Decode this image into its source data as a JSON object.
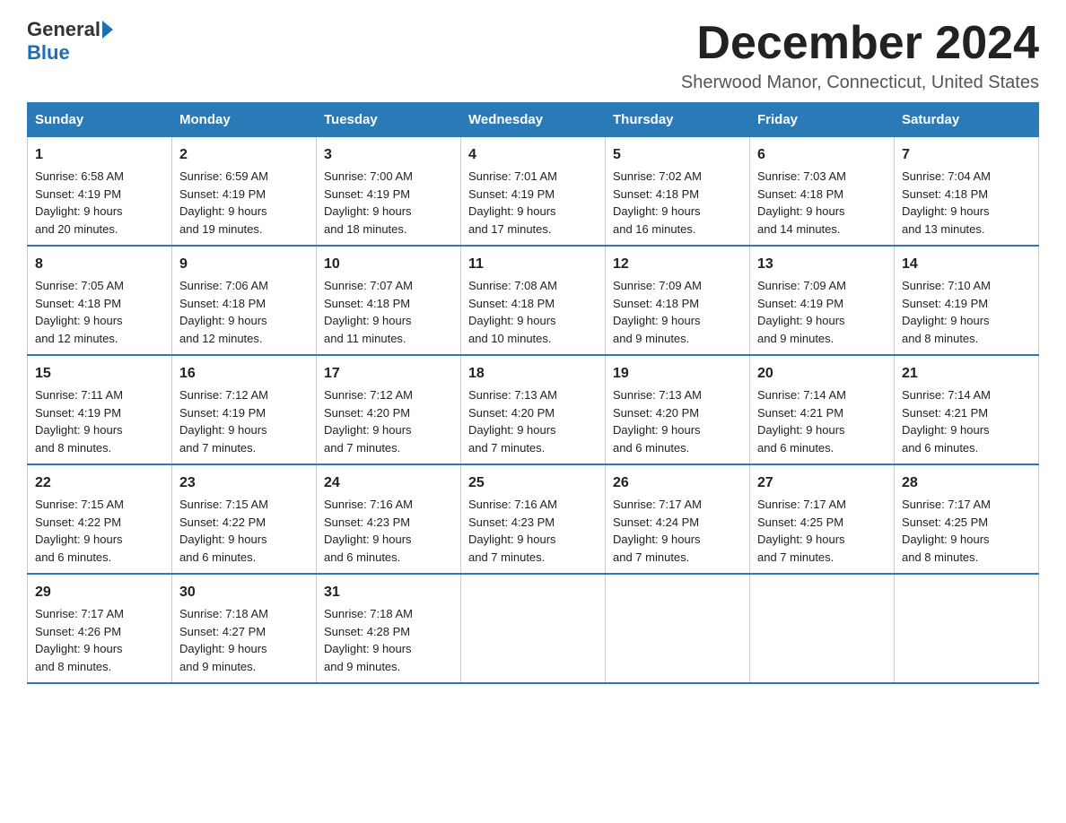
{
  "logo": {
    "general": "General",
    "blue": "Blue"
  },
  "title": "December 2024",
  "location": "Sherwood Manor, Connecticut, United States",
  "days_of_week": [
    "Sunday",
    "Monday",
    "Tuesday",
    "Wednesday",
    "Thursday",
    "Friday",
    "Saturday"
  ],
  "weeks": [
    [
      {
        "day": "1",
        "sunrise": "6:58 AM",
        "sunset": "4:19 PM",
        "daylight": "9 hours and 20 minutes."
      },
      {
        "day": "2",
        "sunrise": "6:59 AM",
        "sunset": "4:19 PM",
        "daylight": "9 hours and 19 minutes."
      },
      {
        "day": "3",
        "sunrise": "7:00 AM",
        "sunset": "4:19 PM",
        "daylight": "9 hours and 18 minutes."
      },
      {
        "day": "4",
        "sunrise": "7:01 AM",
        "sunset": "4:19 PM",
        "daylight": "9 hours and 17 minutes."
      },
      {
        "day": "5",
        "sunrise": "7:02 AM",
        "sunset": "4:18 PM",
        "daylight": "9 hours and 16 minutes."
      },
      {
        "day": "6",
        "sunrise": "7:03 AM",
        "sunset": "4:18 PM",
        "daylight": "9 hours and 14 minutes."
      },
      {
        "day": "7",
        "sunrise": "7:04 AM",
        "sunset": "4:18 PM",
        "daylight": "9 hours and 13 minutes."
      }
    ],
    [
      {
        "day": "8",
        "sunrise": "7:05 AM",
        "sunset": "4:18 PM",
        "daylight": "9 hours and 12 minutes."
      },
      {
        "day": "9",
        "sunrise": "7:06 AM",
        "sunset": "4:18 PM",
        "daylight": "9 hours and 12 minutes."
      },
      {
        "day": "10",
        "sunrise": "7:07 AM",
        "sunset": "4:18 PM",
        "daylight": "9 hours and 11 minutes."
      },
      {
        "day": "11",
        "sunrise": "7:08 AM",
        "sunset": "4:18 PM",
        "daylight": "9 hours and 10 minutes."
      },
      {
        "day": "12",
        "sunrise": "7:09 AM",
        "sunset": "4:18 PM",
        "daylight": "9 hours and 9 minutes."
      },
      {
        "day": "13",
        "sunrise": "7:09 AM",
        "sunset": "4:19 PM",
        "daylight": "9 hours and 9 minutes."
      },
      {
        "day": "14",
        "sunrise": "7:10 AM",
        "sunset": "4:19 PM",
        "daylight": "9 hours and 8 minutes."
      }
    ],
    [
      {
        "day": "15",
        "sunrise": "7:11 AM",
        "sunset": "4:19 PM",
        "daylight": "9 hours and 8 minutes."
      },
      {
        "day": "16",
        "sunrise": "7:12 AM",
        "sunset": "4:19 PM",
        "daylight": "9 hours and 7 minutes."
      },
      {
        "day": "17",
        "sunrise": "7:12 AM",
        "sunset": "4:20 PM",
        "daylight": "9 hours and 7 minutes."
      },
      {
        "day": "18",
        "sunrise": "7:13 AM",
        "sunset": "4:20 PM",
        "daylight": "9 hours and 7 minutes."
      },
      {
        "day": "19",
        "sunrise": "7:13 AM",
        "sunset": "4:20 PM",
        "daylight": "9 hours and 6 minutes."
      },
      {
        "day": "20",
        "sunrise": "7:14 AM",
        "sunset": "4:21 PM",
        "daylight": "9 hours and 6 minutes."
      },
      {
        "day": "21",
        "sunrise": "7:14 AM",
        "sunset": "4:21 PM",
        "daylight": "9 hours and 6 minutes."
      }
    ],
    [
      {
        "day": "22",
        "sunrise": "7:15 AM",
        "sunset": "4:22 PM",
        "daylight": "9 hours and 6 minutes."
      },
      {
        "day": "23",
        "sunrise": "7:15 AM",
        "sunset": "4:22 PM",
        "daylight": "9 hours and 6 minutes."
      },
      {
        "day": "24",
        "sunrise": "7:16 AM",
        "sunset": "4:23 PM",
        "daylight": "9 hours and 6 minutes."
      },
      {
        "day": "25",
        "sunrise": "7:16 AM",
        "sunset": "4:23 PM",
        "daylight": "9 hours and 7 minutes."
      },
      {
        "day": "26",
        "sunrise": "7:17 AM",
        "sunset": "4:24 PM",
        "daylight": "9 hours and 7 minutes."
      },
      {
        "day": "27",
        "sunrise": "7:17 AM",
        "sunset": "4:25 PM",
        "daylight": "9 hours and 7 minutes."
      },
      {
        "day": "28",
        "sunrise": "7:17 AM",
        "sunset": "4:25 PM",
        "daylight": "9 hours and 8 minutes."
      }
    ],
    [
      {
        "day": "29",
        "sunrise": "7:17 AM",
        "sunset": "4:26 PM",
        "daylight": "9 hours and 8 minutes."
      },
      {
        "day": "30",
        "sunrise": "7:18 AM",
        "sunset": "4:27 PM",
        "daylight": "9 hours and 9 minutes."
      },
      {
        "day": "31",
        "sunrise": "7:18 AM",
        "sunset": "4:28 PM",
        "daylight": "9 hours and 9 minutes."
      },
      null,
      null,
      null,
      null
    ]
  ],
  "labels": {
    "sunrise": "Sunrise:",
    "sunset": "Sunset:",
    "daylight": "Daylight:"
  }
}
